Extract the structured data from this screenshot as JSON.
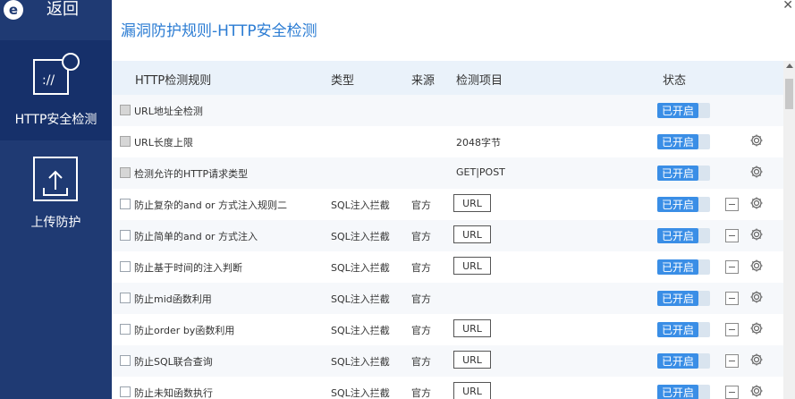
{
  "sidebar": {
    "back_label": "返回",
    "logo_letter": "e",
    "nav": [
      {
        "label": "HTTP安全检测",
        "active": true
      },
      {
        "label": "上传防护",
        "active": false
      }
    ]
  },
  "main": {
    "title": "漏洞防护规则-HTTP安全检测",
    "close_glyph": "✕",
    "columns": {
      "rule": "HTTP检测规则",
      "type": "类型",
      "source": "来源",
      "item": "检测项目",
      "status": "状态"
    },
    "rows": [
      {
        "name": "URL地址全检测",
        "type": "",
        "source": "",
        "item": "",
        "url": false,
        "status": "已开启",
        "disabled": true,
        "minus": false,
        "gear": false
      },
      {
        "name": "URL长度上限",
        "type": "",
        "source": "",
        "item": "2048字节",
        "url": false,
        "status": "已开启",
        "disabled": true,
        "minus": false,
        "gear": true
      },
      {
        "name": "检测允许的HTTP请求类型",
        "type": "",
        "source": "",
        "item": "GET|POST",
        "url": false,
        "status": "已开启",
        "disabled": true,
        "minus": false,
        "gear": true
      },
      {
        "name": "防止复杂的and or 方式注入规则二",
        "type": "SQL注入拦截",
        "source": "官方",
        "item": "URL",
        "url": true,
        "status": "已开启",
        "disabled": false,
        "minus": true,
        "gear": true
      },
      {
        "name": "防止简单的and or 方式注入",
        "type": "SQL注入拦截",
        "source": "官方",
        "item": "URL",
        "url": true,
        "status": "已开启",
        "disabled": false,
        "minus": true,
        "gear": true
      },
      {
        "name": "防止基于时间的注入判断",
        "type": "SQL注入拦截",
        "source": "官方",
        "item": "URL",
        "url": true,
        "status": "已开启",
        "disabled": false,
        "minus": true,
        "gear": true
      },
      {
        "name": "防止mid函数利用",
        "type": "SQL注入拦截",
        "source": "官方",
        "item": "",
        "url": false,
        "status": "已开启",
        "disabled": false,
        "minus": true,
        "gear": true
      },
      {
        "name": "防止order by函数利用",
        "type": "SQL注入拦截",
        "source": "官方",
        "item": "URL",
        "url": true,
        "status": "已开启",
        "disabled": false,
        "minus": true,
        "gear": true
      },
      {
        "name": "防止SQL联合查询",
        "type": "SQL注入拦截",
        "source": "官方",
        "item": "URL",
        "url": true,
        "status": "已开启",
        "disabled": false,
        "minus": true,
        "gear": true
      },
      {
        "name": "防止未知函数执行",
        "type": "SQL注入拦截",
        "source": "官方",
        "item": "URL",
        "url": true,
        "status": "已开启",
        "disabled": false,
        "minus": true,
        "gear": true
      }
    ]
  },
  "colors": {
    "sidebar_bg": "#1f3a73",
    "accent": "#2b7cd3",
    "toggle_on": "#3a8ee6"
  }
}
